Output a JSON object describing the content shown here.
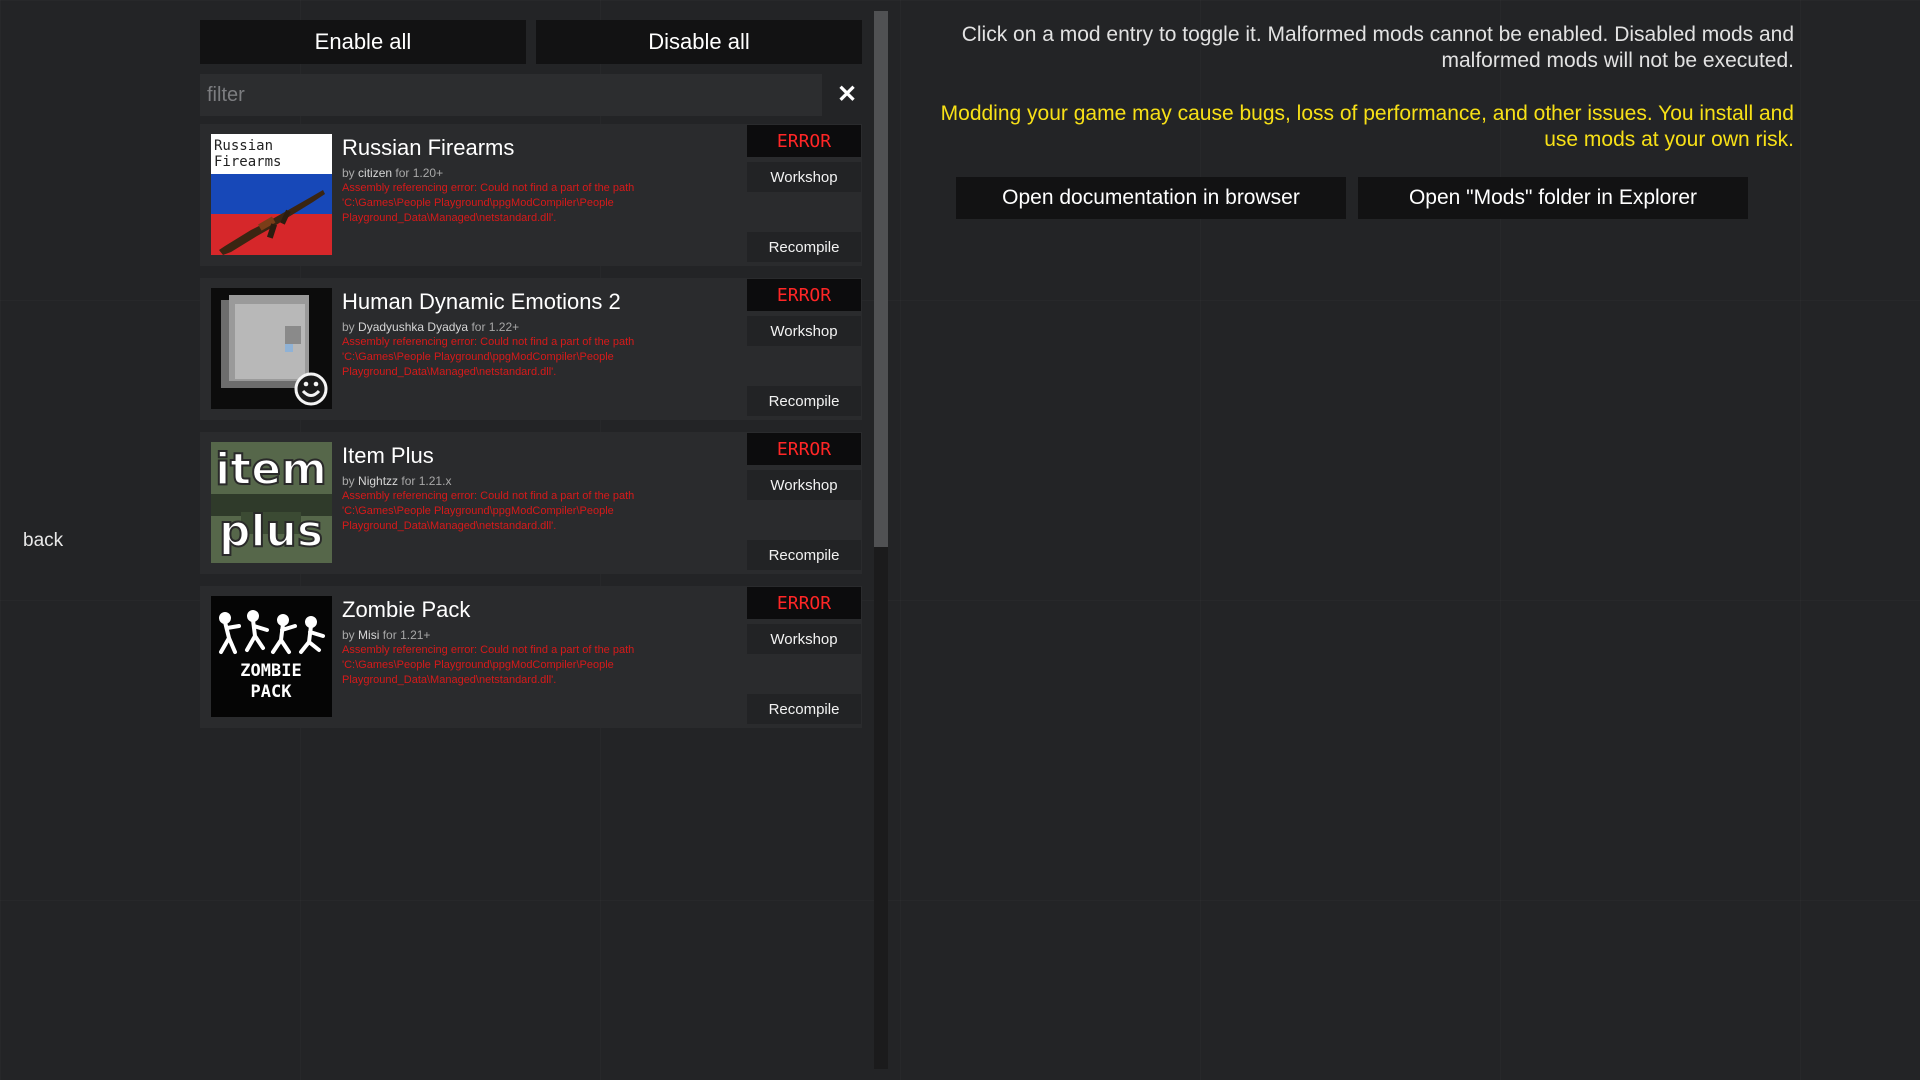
{
  "nav": {
    "back_label": "back"
  },
  "toolbar": {
    "enable_all_label": "Enable all",
    "disable_all_label": "Disable all"
  },
  "filter": {
    "placeholder": "filter",
    "value": "",
    "clear_icon": "close-icon",
    "clear_glyph": "✕"
  },
  "mods": [
    {
      "title": "Russian Firearms",
      "by_label": "by",
      "author": "citizen",
      "for_label": "for",
      "version": "1.20+",
      "error_text": "Assembly referencing error: Could not find a part of the path 'C:\\Games\\People Playground\\ppgModCompiler\\People Playground_Data\\Managed\\netstandard.dll'.",
      "status": "ERROR",
      "workshop_label": "Workshop",
      "recompile_label": "Recompile",
      "thumb_icon": "russian-flag-rifle-thumbnail",
      "thumb_text": [
        "Russian",
        "Firearms"
      ]
    },
    {
      "title": "Human Dynamic Emotions 2",
      "by_label": "by",
      "author": "Dyadyushka Dyadya",
      "for_label": "for",
      "version": "1.22+",
      "error_text": "Assembly referencing error: Could not find a part of the path 'C:\\Games\\People Playground\\ppgModCompiler\\People Playground_Data\\Managed\\netstandard.dll'.",
      "status": "ERROR",
      "workshop_label": "Workshop",
      "recompile_label": "Recompile",
      "thumb_icon": "grey-squares-smiley-thumbnail",
      "thumb_text": []
    },
    {
      "title": "Item Plus",
      "by_label": "by",
      "author": "Nightzz",
      "for_label": "for",
      "version": "1.21.x",
      "error_text": "Assembly referencing error: Could not find a part of the path 'C:\\Games\\People Playground\\ppgModCompiler\\People Playground_Data\\Managed\\netstandard.dll'.",
      "status": "ERROR",
      "workshop_label": "Workshop",
      "recompile_label": "Recompile",
      "thumb_icon": "item-plus-logo-thumbnail",
      "thumb_text": [
        "item",
        "plus"
      ]
    },
    {
      "title": "Zombie Pack",
      "by_label": "by",
      "author": "Misi",
      "for_label": "for",
      "version": "1.21+",
      "error_text": "Assembly referencing error: Could not find a part of the path 'C:\\Games\\People Playground\\ppgModCompiler\\People Playground_Data\\Managed\\netstandard.dll'.",
      "status": "ERROR",
      "workshop_label": "Workshop",
      "recompile_label": "Recompile",
      "thumb_icon": "zombie-pack-logo-thumbnail",
      "thumb_text": [
        "ZOMBIE",
        "PACK"
      ]
    }
  ],
  "info": {
    "instructions": "Click on a mod entry to toggle it. Malformed mods cannot be enabled. Disabled mods and malformed mods will not be executed.",
    "warning": "Modding your game may cause bugs, loss of performance, and other issues. You install and use mods at your own risk."
  },
  "actions": {
    "open_docs_label": "Open documentation in browser",
    "open_folder_label": "Open \"Mods\" folder in Explorer"
  },
  "colors": {
    "background": "#232426",
    "panel": "#2a2b2d",
    "button": "#121213",
    "error_red": "#ff2626",
    "warning_yellow": "#f7e017"
  }
}
